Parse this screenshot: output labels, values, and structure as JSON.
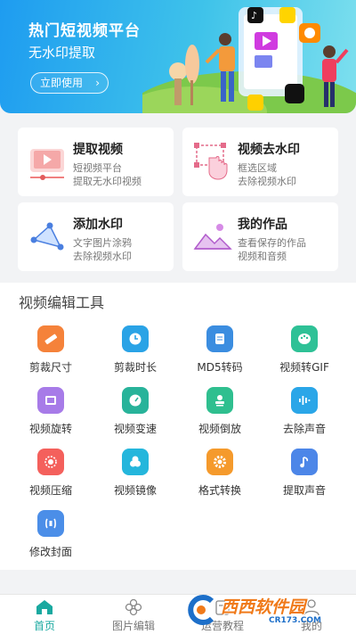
{
  "banner": {
    "title": "热门短视频平台",
    "subtitle": "无水印提取",
    "button_label": "立即使用"
  },
  "cards": [
    {
      "title": "提取视频",
      "line1": "短视频平台",
      "line2": "提取无水印视频",
      "icon": "video-extract-icon"
    },
    {
      "title": "视频去水印",
      "line1": "框选区域",
      "line2": "去除视频水印",
      "icon": "select-hand-icon"
    },
    {
      "title": "添加水印",
      "line1": "文字图片涂鸦",
      "line2": "去除视频水印",
      "icon": "shape-pen-icon"
    },
    {
      "title": "我的作品",
      "line1": "查看保存的作品",
      "line2": "视频和音频",
      "icon": "gallery-icon"
    }
  ],
  "tools_section": {
    "title": "视频编辑工具",
    "items": [
      {
        "label": "剪裁尺寸",
        "icon": "ruler-icon",
        "color": "#f5823a"
      },
      {
        "label": "剪裁时长",
        "icon": "clock-icon",
        "color": "#2aa3e6"
      },
      {
        "label": "MD5转码",
        "icon": "scroll-icon",
        "color": "#3b8de0"
      },
      {
        "label": "视频转GIF",
        "icon": "palette-icon",
        "color": "#2ec196"
      },
      {
        "label": "视频旋转",
        "icon": "tablet-icon",
        "color": "#a77be8"
      },
      {
        "label": "视频变速",
        "icon": "speedometer-icon",
        "color": "#28b39a"
      },
      {
        "label": "视频倒放",
        "icon": "stamp-icon",
        "color": "#2fbf8f"
      },
      {
        "label": "去除声音",
        "icon": "sound-wave-icon",
        "color": "#2aa6e8"
      },
      {
        "label": "视频压缩",
        "icon": "compress-icon",
        "color": "#f4605c"
      },
      {
        "label": "视频镜像",
        "icon": "mirror-icon",
        "color": "#24b6dc"
      },
      {
        "label": "格式转换",
        "icon": "gear-icon",
        "color": "#f59a2c"
      },
      {
        "label": "提取声音",
        "icon": "music-note-icon",
        "color": "#4c86e8"
      },
      {
        "label": "修改封面",
        "icon": "cover-icon",
        "color": "#4b8ee8"
      }
    ]
  },
  "tabbar": {
    "tabs": [
      {
        "label": "首页",
        "icon": "home-icon",
        "active": true
      },
      {
        "label": "图片编辑",
        "icon": "flower-icon",
        "active": false
      },
      {
        "label": "运营教程",
        "icon": "book-icon",
        "active": false
      },
      {
        "label": "我的",
        "icon": "user-icon",
        "active": false
      }
    ],
    "active_color": "#1aa9a0"
  },
  "watermark": {
    "text": "西西软件园",
    "sub": "CR173.COM"
  }
}
